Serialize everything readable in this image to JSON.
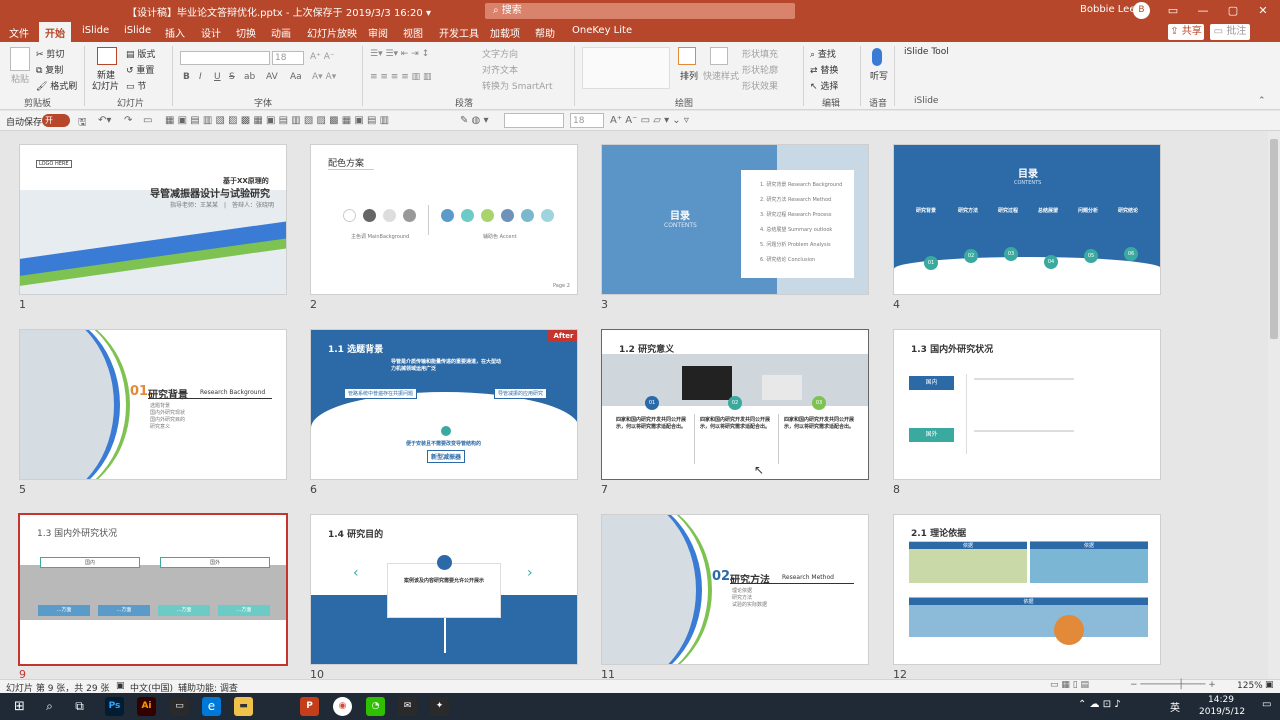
{
  "window": {
    "title": "【设计稿】毕业论文答辩优化.pptx - 上次保存于 2019/3/3 16:20 ▾",
    "search_placeholder": "搜索",
    "user": "Bobbie Lee",
    "avatar_text": "B",
    "min": "—",
    "max": "▢",
    "close": "✕",
    "ribbon_toggle": "▭"
  },
  "tabs": [
    "文件",
    "开始",
    "iSlide",
    "iSlide",
    "插入",
    "设计",
    "切换",
    "动画",
    "幻灯片放映",
    "审阅",
    "视图",
    "开发工具",
    "加载项",
    "帮助",
    "OneKey Lite"
  ],
  "share": "共享",
  "comment": "批注",
  "ribbon": {
    "clipboard": {
      "paste": "粘贴",
      "cut": "剪切",
      "copy": "复制",
      "format": "格式刷",
      "group": "剪贴板"
    },
    "slides": {
      "new": "新建",
      "new2": "幻灯片",
      "layout": "版式",
      "reset": "重置",
      "section": "节",
      "group": "幻灯片"
    },
    "font": {
      "size": "18",
      "group": "字体",
      "bold": "B",
      "italic": "I",
      "underline": "U",
      "strike": "S",
      "shadow": "ab",
      "spacing": "AV",
      "case": "Aa"
    },
    "paragraph": {
      "direction": "文字方向",
      "align": "对齐文本",
      "smartart": "转换为 SmartArt",
      "group": "段落"
    },
    "drawing": {
      "arrange": "排列",
      "quick": "快速样式",
      "fill": "形状填充",
      "outline": "形状轮廓",
      "effect": "形状效果",
      "group": "绘图"
    },
    "editing": {
      "find": "查找",
      "replace": "替换",
      "select": "选择",
      "group": "编辑"
    },
    "voice": {
      "dictate": "听写",
      "group": "语音"
    },
    "islide": {
      "tool": "iSlide Tool",
      "group": "iSlide"
    }
  },
  "qat": {
    "autosave": "自动保存",
    "toggle": "开",
    "size": "18"
  },
  "slides": [
    {
      "num": "1",
      "logo": "LOGO HERE",
      "sub": "基于XX原理的",
      "title": "导管减振器设计与试验研究",
      "meta": "指导老师：王某某　|　答辩人：张晓明"
    },
    {
      "num": "2",
      "title": "配色方案",
      "a": "主色调 MainBackground",
      "b": "辅助色 Accent",
      "page": "Page 2"
    },
    {
      "num": "3",
      "title": "目录",
      "en": "CONTENTS",
      "items": [
        "1. 研究背景  Research Background",
        "2. 研究方法  Research Method",
        "3. 研究过程  Research Process",
        "4. 总结展望  Summary outlook",
        "5. 问题分析  Problem Analysis",
        "6. 研究结论  Conclusion"
      ]
    },
    {
      "num": "4",
      "title": "目录",
      "en": "CONTENTS",
      "labels": [
        "研究背景",
        "研究方法",
        "研究过程",
        "总结展望",
        "问题分析",
        "研究结论"
      ],
      "dots": [
        "01",
        "02",
        "03",
        "04",
        "05",
        "06"
      ]
    },
    {
      "num": "5",
      "n": "01.",
      "title": "研究背景",
      "en": "Research Background",
      "bullets": [
        "选题背景",
        "国内外研究现状",
        "国内外研究目的",
        "研究意义"
      ]
    },
    {
      "num": "6",
      "title": "1.1 选题背景",
      "badge": "After",
      "top": "导管是介质传输和能量传递的重要通道，在大型动力机械领域运用广泛",
      "left": "管路系统中普遍存在共振问题",
      "right": "导管减振的应用研究",
      "bottom": "便于安装且不需要改变导管结构的",
      "tag": "新型减振器"
    },
    {
      "num": "7",
      "title": "1.2 研究意义",
      "dots": [
        "01",
        "02",
        "03"
      ],
      "col": "四家和国内研究开发共同公开展示，何以将研究需求适配合出。"
    },
    {
      "num": "8",
      "title": "1.3 国内外研究状况",
      "b1": "国内",
      "b2": "国外"
    },
    {
      "num": "9",
      "title": "1.3 国内外研究状况",
      "p1": "国内",
      "p2": "国外",
      "boxes": [
        "...方面",
        "...方面",
        "...方面",
        "...方面"
      ]
    },
    {
      "num": "10",
      "title": "1.4 研究目的",
      "head": "案例该及内容研究需要允许公开展示"
    },
    {
      "num": "11",
      "n": "02.",
      "title": "研究方法",
      "en": "Research Method",
      "bullets": [
        "理论依据",
        "研究方法",
        "试验的实际数据"
      ]
    },
    {
      "num": "12",
      "title": "2.1 理论依据",
      "l1": "依据",
      "l2": "依据",
      "l3": "依据"
    }
  ],
  "status": {
    "slide": "幻灯片 第 9 张，共 29 张",
    "lang": "中文(中国)",
    "access": "辅助功能: 调查",
    "zoom": "125%"
  },
  "taskbar": {
    "time": "14:29",
    "date": "2019/5/12",
    "ime": "英"
  }
}
